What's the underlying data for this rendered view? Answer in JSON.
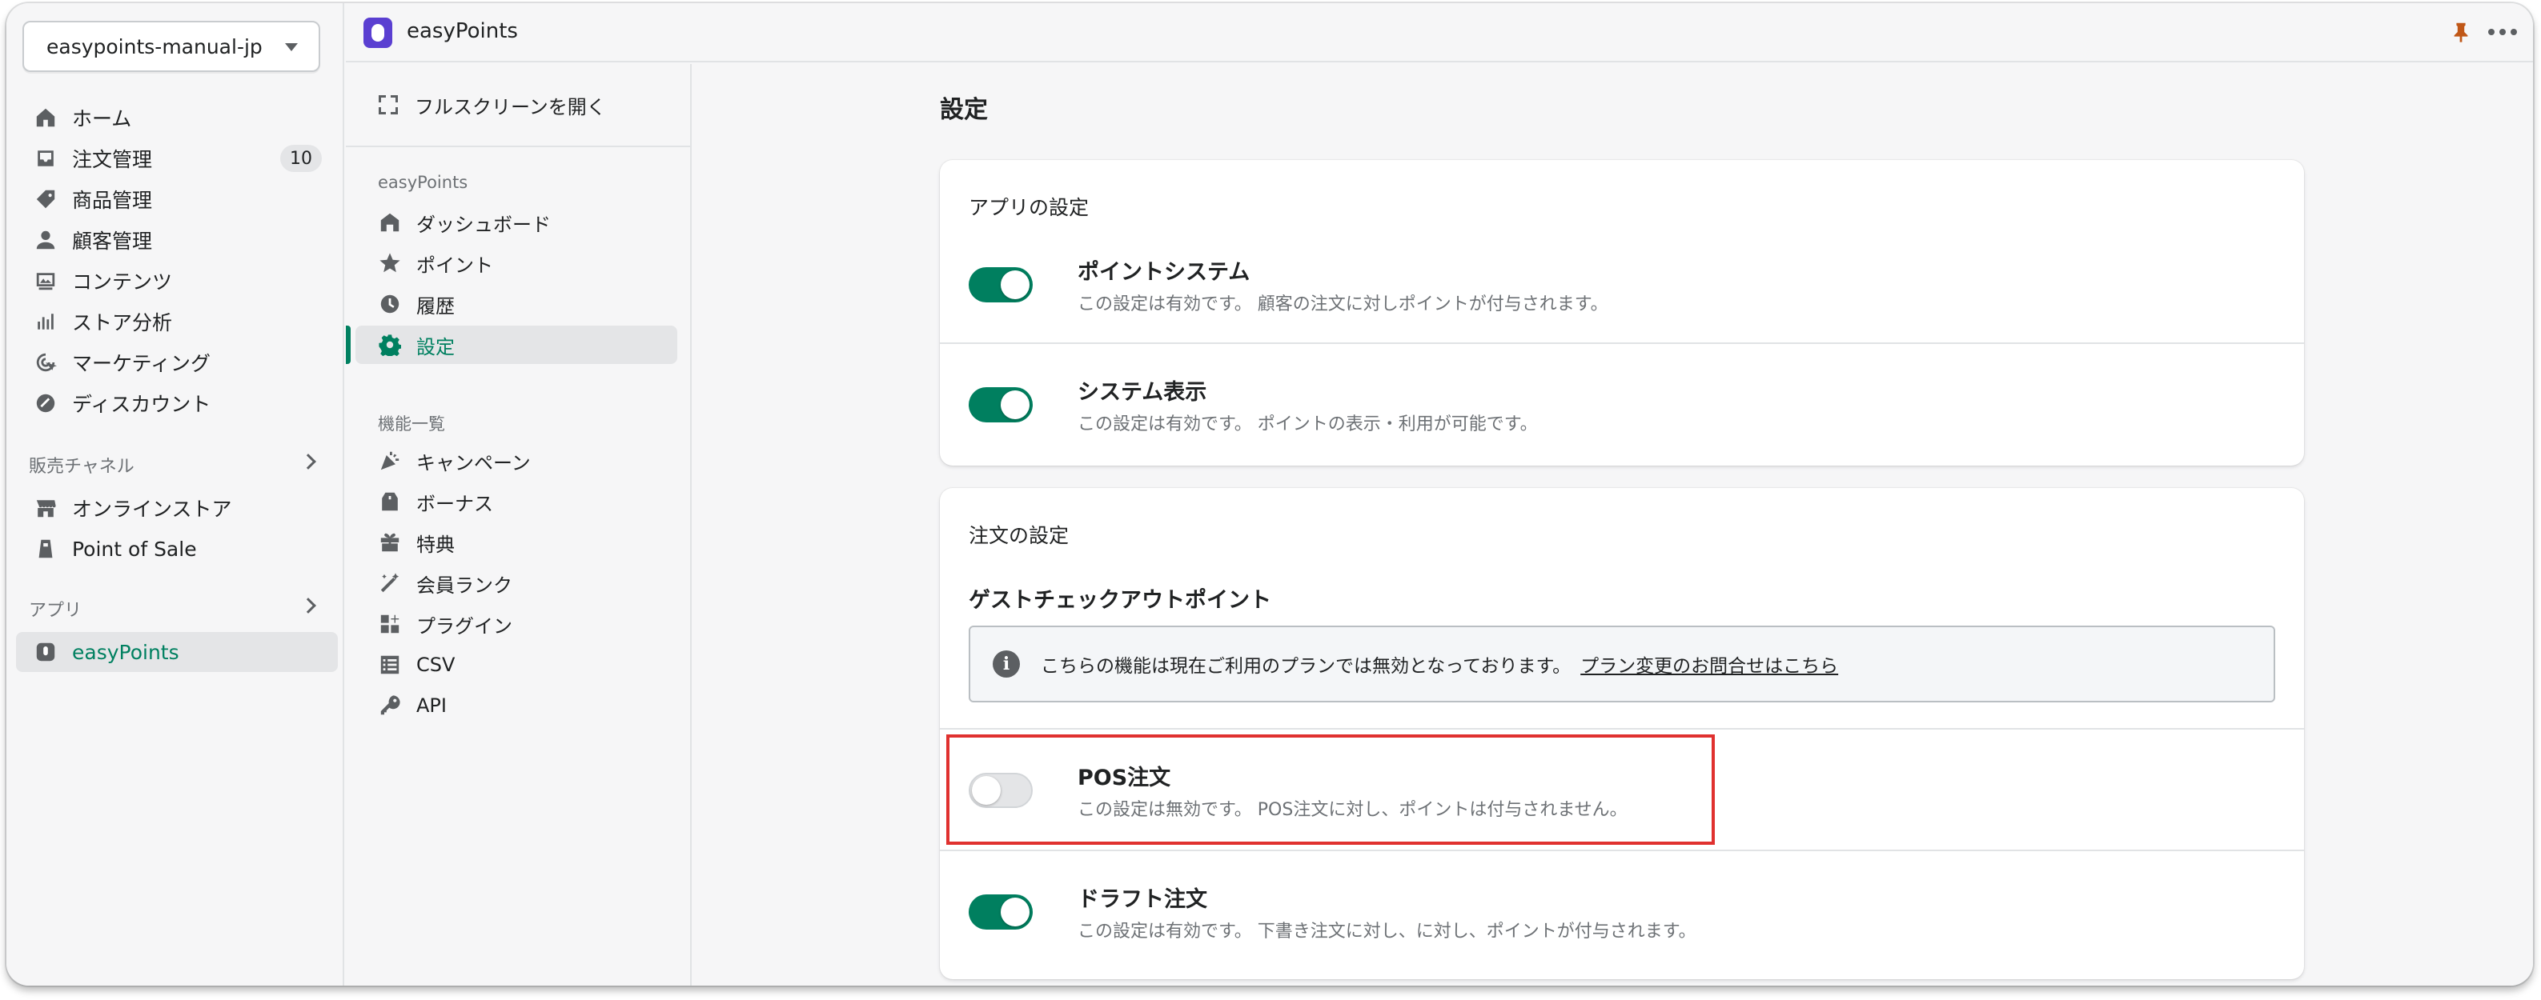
{
  "store": {
    "name": "easypoints-manual-jp"
  },
  "admin_nav": {
    "items": [
      {
        "label": "ホーム",
        "icon": "home-icon"
      },
      {
        "label": "注文管理",
        "icon": "inbox-icon",
        "badge": "10"
      },
      {
        "label": "商品管理",
        "icon": "tag-icon"
      },
      {
        "label": "顧客管理",
        "icon": "person-icon"
      },
      {
        "label": "コンテンツ",
        "icon": "image-icon"
      },
      {
        "label": "ストア分析",
        "icon": "bar-chart-icon"
      },
      {
        "label": "マーケティング",
        "icon": "target-icon"
      },
      {
        "label": "ディスカウント",
        "icon": "discount-icon"
      }
    ],
    "sales_channels_label": "販売チャネル",
    "channels": [
      {
        "label": "オンラインストア",
        "icon": "store-icon"
      },
      {
        "label": "Point of Sale",
        "icon": "pos-bag-icon"
      }
    ],
    "apps_label": "アプリ",
    "apps": [
      {
        "label": "easyPoints",
        "icon": "easypoints-icon"
      }
    ]
  },
  "topbar": {
    "app_name": "easyPoints"
  },
  "app_nav": {
    "fullscreen_label": "フルスクリーンを開く",
    "section1_heading": "easyPoints",
    "section1": [
      {
        "label": "ダッシュボード",
        "icon": "dashboard-icon"
      },
      {
        "label": "ポイント",
        "icon": "star-icon"
      },
      {
        "label": "履歴",
        "icon": "clock-icon"
      },
      {
        "label": "設定",
        "icon": "gear-icon"
      }
    ],
    "section2_heading": "機能一覧",
    "section2": [
      {
        "label": "キャンペーン",
        "icon": "party-icon"
      },
      {
        "label": "ボーナス",
        "icon": "gift-tag-icon"
      },
      {
        "label": "特典",
        "icon": "gift-icon"
      },
      {
        "label": "会員ランク",
        "icon": "wand-icon"
      },
      {
        "label": "プラグイン",
        "icon": "apps-icon"
      },
      {
        "label": "CSV",
        "icon": "list-icon"
      },
      {
        "label": "API",
        "icon": "key-icon"
      }
    ]
  },
  "main": {
    "page_title": "設定",
    "app_settings": {
      "heading": "アプリの設定",
      "rows": [
        {
          "title": "ポイントシステム",
          "desc": "この設定は有効です。 顧客の注文に対しポイントが付与されます。",
          "enabled": true
        },
        {
          "title": "システム表示",
          "desc": "この設定は有効です。 ポイントの表示・利用が可能です。",
          "enabled": true
        }
      ]
    },
    "order_settings": {
      "heading": "注文の設定",
      "guest_title": "ゲストチェックアウトポイント",
      "notice_text": "こちらの機能は現在ご利用のプランでは無効となっております。",
      "notice_link": "プラン変更のお問合せはこちら",
      "rows": [
        {
          "title": "POS注文",
          "desc": "この設定は無効です。 POS注文に対し、ポイントは付与されません。",
          "enabled": false
        },
        {
          "title": "ドラフト注文",
          "desc": "この設定は有効です。 下書き注文に対し、に対し、ポイントが付与されます。",
          "enabled": true
        }
      ]
    }
  },
  "colors": {
    "accent": "#008060",
    "toggle_on": "#007f5f",
    "highlight": "#e0312f",
    "app_logo": "#5a3fd1"
  }
}
